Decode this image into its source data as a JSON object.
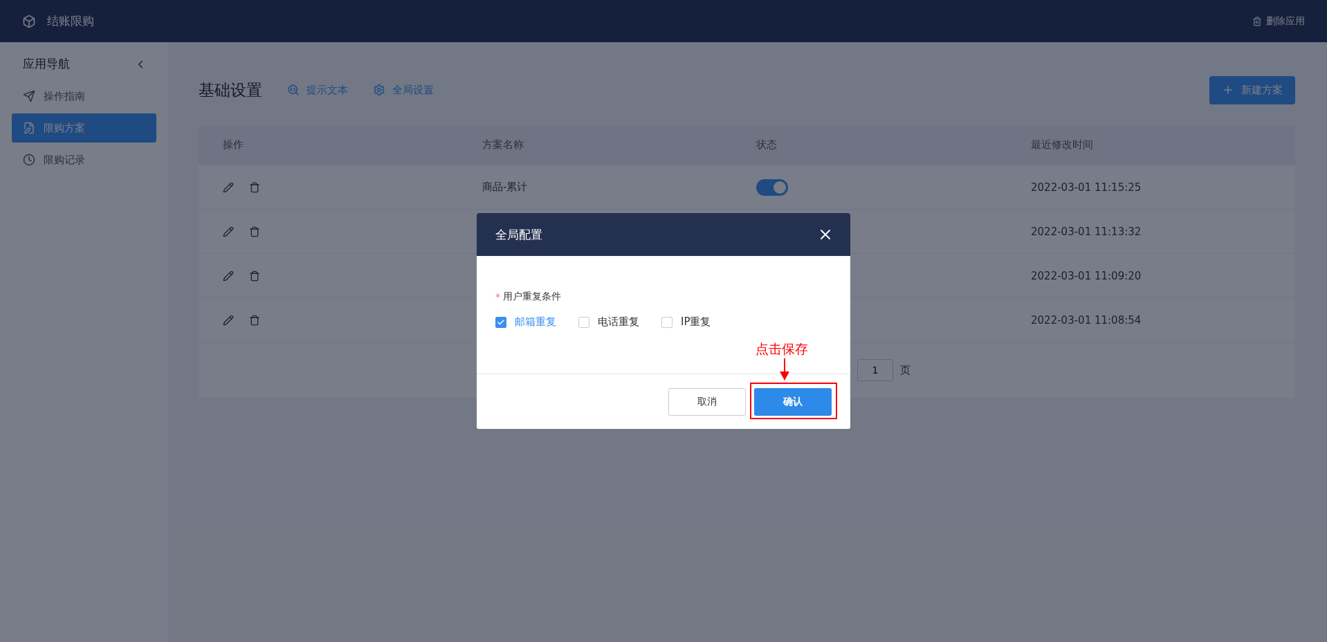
{
  "app_bar": {
    "title": "结账限购",
    "action": "删除应用"
  },
  "sidebar": {
    "heading": "应用导航",
    "items": [
      {
        "label": "操作指南",
        "kind": "guide",
        "selected": false
      },
      {
        "label": "限购方案",
        "kind": "plan",
        "selected": true
      },
      {
        "label": "限购记录",
        "kind": "record",
        "selected": false
      }
    ]
  },
  "page": {
    "title": "基础设置",
    "links": [
      {
        "label": "提示文本",
        "kind": "text"
      },
      {
        "label": "全局设置",
        "kind": "gear"
      }
    ],
    "new_button": "新建方案"
  },
  "table": {
    "columns": [
      "操作",
      "方案名称",
      "状态",
      "最近修改时间"
    ],
    "rows": [
      {
        "name": "商品-累计",
        "status": {
          "on": true
        },
        "modified": "2022-03-01 11:15:25"
      },
      {
        "modified": "2022-03-01 11:13:32"
      },
      {
        "modified": "2022-03-01 11:09:20"
      },
      {
        "modified": "2022-03-01 11:08:54"
      }
    ]
  },
  "pagination": {
    "page": "1",
    "suffix": "页"
  },
  "dialog": {
    "title": "全局配置",
    "field_label": "用户重复条件",
    "required_mark": "*",
    "options": [
      {
        "label": "邮箱重复",
        "checked": true
      },
      {
        "label": "电话重复",
        "checked": false
      },
      {
        "label": "IP重复",
        "checked": false
      }
    ],
    "cancel": "取消",
    "confirm": "确认"
  },
  "annotation": {
    "text": "点击保存"
  }
}
